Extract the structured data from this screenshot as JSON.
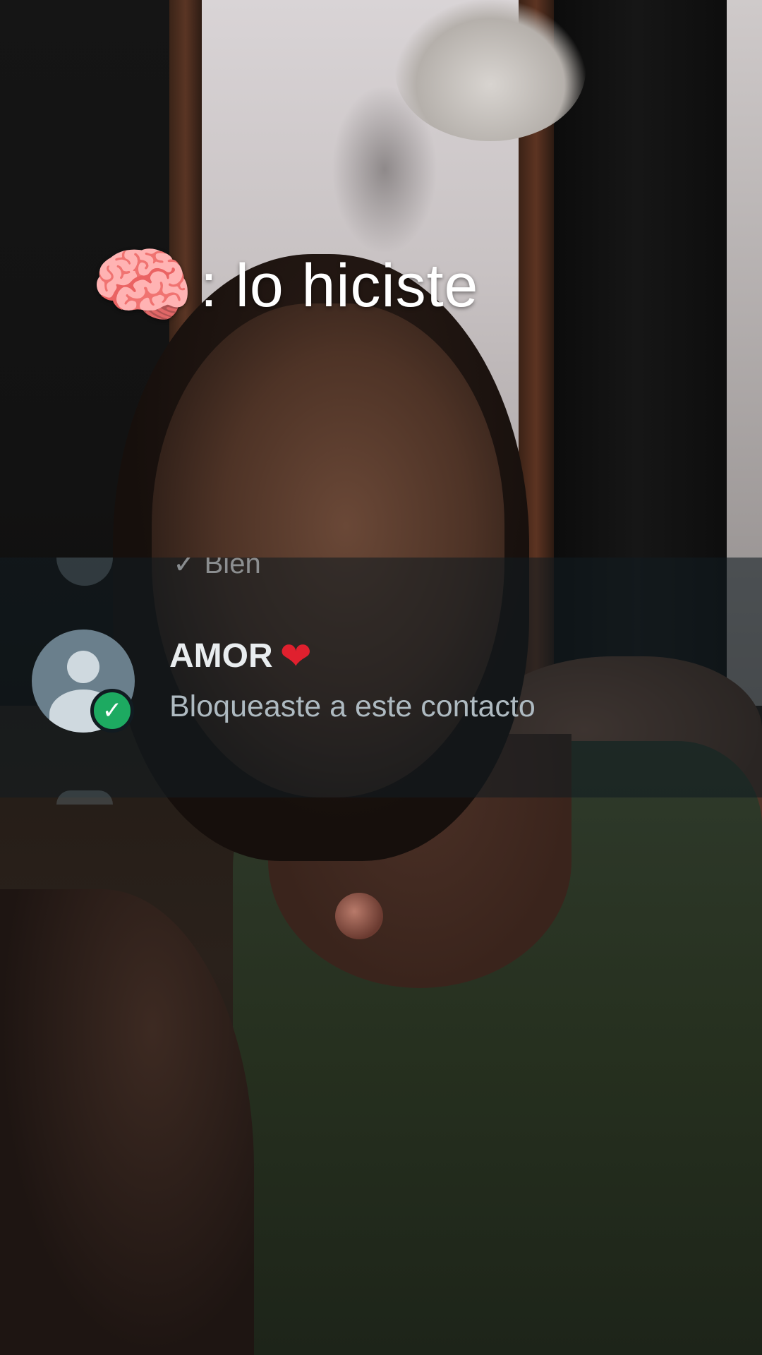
{
  "caption": {
    "icon": "brain-icon",
    "text": ": lo hiciste"
  },
  "chat_list": {
    "previous_item_preview": "✓ Bien",
    "current_item": {
      "name": "AMOR",
      "name_icon": "heart-icon",
      "status": "Bloqueaste a este contacto",
      "avatar_badge_icon": "check-icon"
    }
  },
  "colors": {
    "badge_green": "#1daa61",
    "heart_red": "#e0202e",
    "overlay_band": "#111b21"
  }
}
